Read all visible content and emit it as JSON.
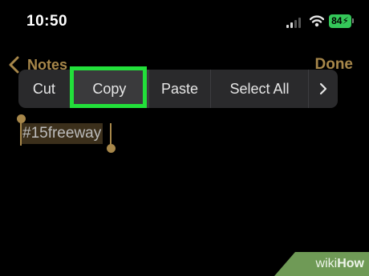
{
  "status_bar": {
    "time": "10:50",
    "battery": "84"
  },
  "nav": {
    "back_label": "Notes",
    "done_label": "Done"
  },
  "edit_menu": {
    "items": [
      "Cut",
      "Copy",
      "Paste",
      "Select All"
    ],
    "more_icon": "chevron-right-icon",
    "highlighted_item": "Copy"
  },
  "note": {
    "selected_text": "#15freeway"
  },
  "watermark": {
    "wiki": "wiki",
    "how": "How"
  },
  "colors": {
    "accent": "#a7874a",
    "highlight_border": "#22e03a",
    "battery": "#34c759",
    "background": "#000000"
  }
}
